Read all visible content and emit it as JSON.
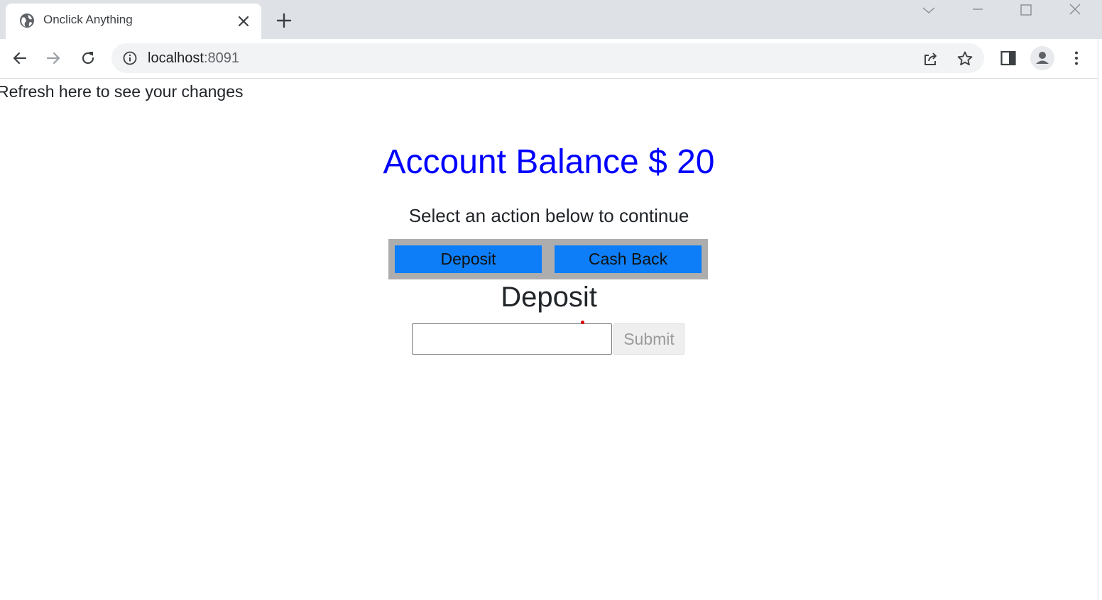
{
  "browser": {
    "tab": {
      "title": "Onclick Anything"
    },
    "address_bar": {
      "host": "localhost",
      "port": ":8091"
    }
  },
  "page": {
    "refresh_note": "Refresh here to see your changes",
    "balance_heading": "Account Balance $ 20",
    "instruction": "Select an action below to continue",
    "actions": [
      {
        "label": "Deposit"
      },
      {
        "label": "Cash Back"
      }
    ],
    "mode_title": "Deposit",
    "amount_input": {
      "value": "",
      "placeholder": ""
    },
    "submit_label": "Submit",
    "colors": {
      "heading": "#0000ff",
      "action_button": "#0d7ef8",
      "action_box": "#adadad"
    }
  }
}
